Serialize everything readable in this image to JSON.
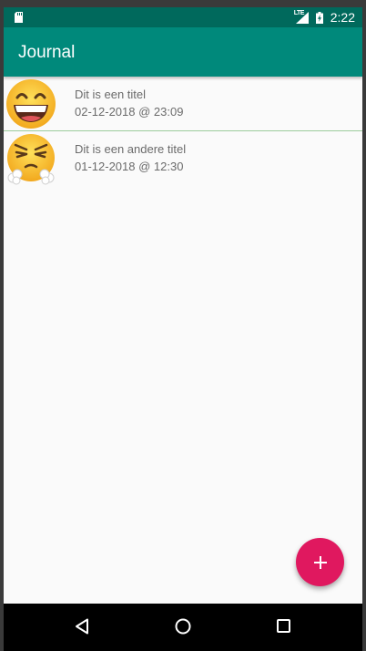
{
  "statusbar": {
    "time": "2:22",
    "network_label": "LTE",
    "icons": [
      "sd-card-icon",
      "lte-signal-icon",
      "battery-charging-icon"
    ]
  },
  "appbar": {
    "title": "Journal"
  },
  "entries": [
    {
      "title": "Dit is een titel",
      "date": "02-12-2018 @ 23:09",
      "mood_icon": "grinning-face-icon"
    },
    {
      "title": "Dit is een andere titel",
      "date": "01-12-2018 @ 12:30",
      "mood_icon": "steaming-angry-face-icon"
    }
  ],
  "fab": {
    "icon": "plus-icon"
  },
  "navigation": {
    "icons": [
      "back-icon",
      "home-icon",
      "recents-icon"
    ]
  },
  "colors": {
    "status_bar": "#00695c",
    "app_bar": "#00897b",
    "fab": "#e0185f",
    "background": "#fafafa",
    "text_secondary": "#6b6b6b"
  }
}
